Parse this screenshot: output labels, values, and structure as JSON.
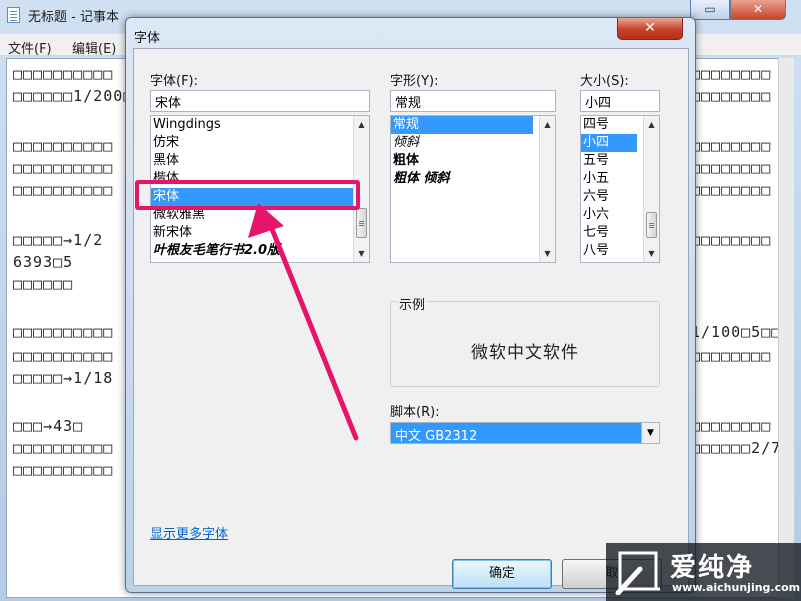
{
  "notepad": {
    "title": "无标题 - 记事本",
    "menu": [
      "文件(F)",
      "编辑(E)"
    ],
    "text_lines": [
      "□□□□□□□□□□",
      "□□□□□□1/200□",
      "□□□□□□□□□□",
      "□□□□□□□□□□",
      "□□□□□□□□□□",
      "□□□□□→1/2",
      "6393□5",
      "□□□□□□",
      "□□□□□□□□□□",
      "□□□□□□□□□□",
      "□□□□□→1/18",
      "□□□→43□",
      "□□□□□□□□□□",
      "□□□□□□□□□□"
    ],
    "right_lines": [
      "□□□□□□□□",
      "□□□□□□□□",
      "□□□□□□□□",
      "□□□□□□□□",
      "□□□□□□□□",
      "□□□□□□□□",
      "1/100□5□□",
      "□□□□□□□□",
      "□□□□□□□□",
      "□□□□□□2/7□"
    ]
  },
  "dialog": {
    "title": "字体",
    "close_label": "✕",
    "font_label": "字体(F):",
    "font_value": "宋体",
    "font_list": [
      "Wingdings",
      "仿宋",
      "黑体",
      "楷体",
      "宋体",
      "微软雅黑",
      "新宋体",
      "叶根友毛笔行书2.0版"
    ],
    "font_selected_index": 4,
    "style_label": "字形(Y):",
    "style_value": "常规",
    "style_list": [
      "常规",
      "倾斜",
      "粗体",
      "粗体 倾斜"
    ],
    "style_selected_index": 0,
    "size_label": "大小(S):",
    "size_value": "小四",
    "size_list": [
      "四号",
      "小四",
      "五号",
      "小五",
      "六号",
      "小六",
      "七号",
      "八号"
    ],
    "size_selected_index": 1,
    "sample_legend": "示例",
    "sample_text": "微软中文软件",
    "script_label": "脚本(R):",
    "script_value": "中文 GB2312",
    "more_fonts_link": "显示更多字体",
    "ok_label": "确定",
    "cancel_label": "取"
  },
  "watermark": {
    "brand": "爱纯净",
    "url": "www.aichunjing.com"
  },
  "colors": {
    "selection": "#3399ff",
    "annotation": "#e6156b"
  }
}
